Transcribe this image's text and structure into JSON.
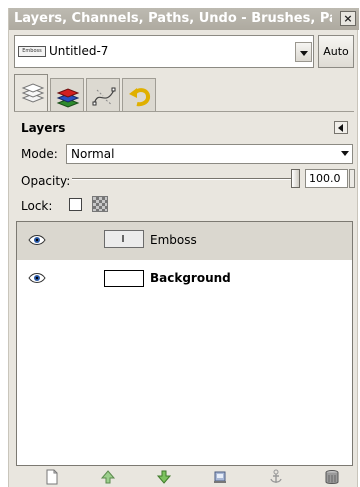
{
  "window": {
    "title": "Layers, Channels, Paths, Undo - Brushes, Patter...",
    "close_glyph": "×"
  },
  "image_menu": {
    "thumbnail_text": "Emboss",
    "image_name": "Untitled-7",
    "auto_label": "Auto"
  },
  "tabs": [
    {
      "icon": "layers-tab-icon"
    },
    {
      "icon": "channels-tab-icon"
    },
    {
      "icon": "paths-tab-icon"
    },
    {
      "icon": "undo-tab-icon"
    }
  ],
  "layers_panel": {
    "title": "Layers",
    "mode_label": "Mode:",
    "mode_value": "Normal",
    "opacity_label": "Opacity:",
    "opacity_value": "100.0",
    "lock_label": "Lock:"
  },
  "layers": [
    {
      "name": "Emboss",
      "visible": true,
      "selected": true
    },
    {
      "name": "Background",
      "visible": true,
      "selected": false
    }
  ],
  "bottom_tools": [
    "new-layer-icon",
    "raise-layer-icon",
    "lower-layer-icon",
    "duplicate-layer-icon",
    "anchor-layer-icon",
    "delete-layer-icon"
  ]
}
